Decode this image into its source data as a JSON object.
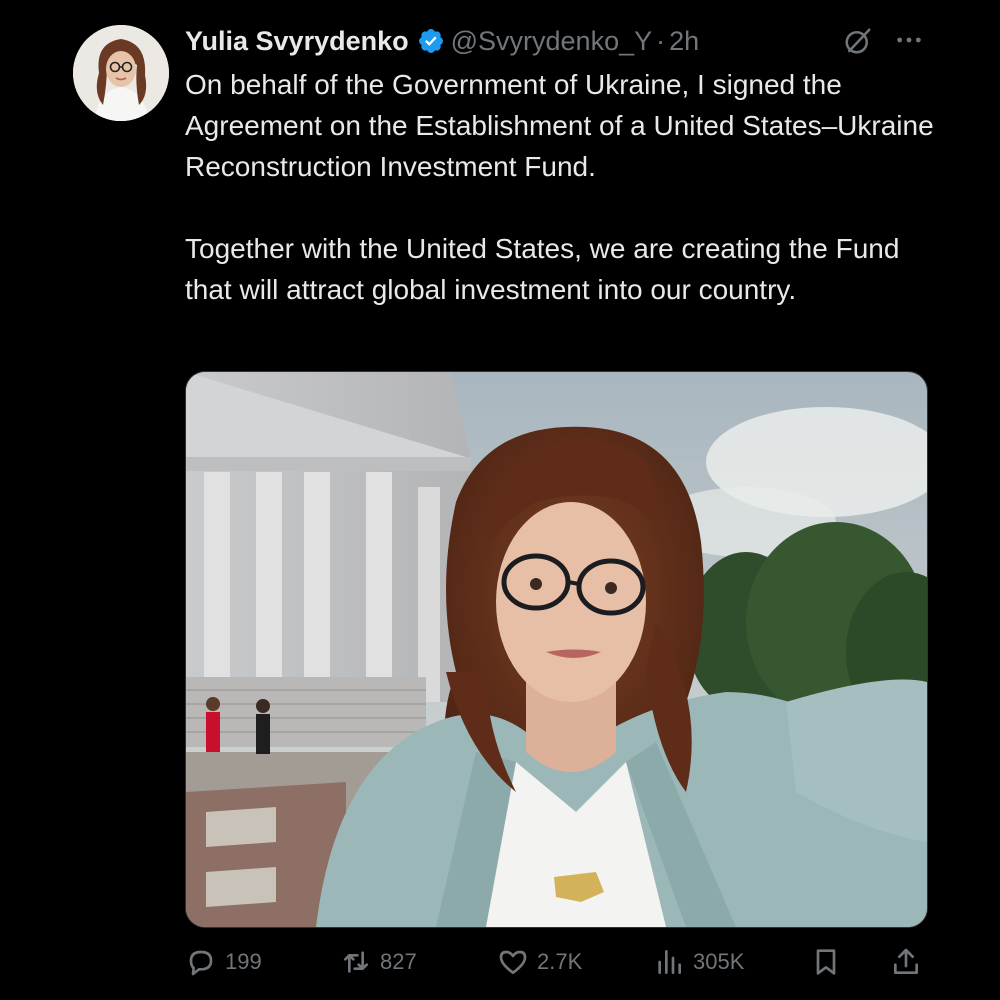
{
  "author": {
    "name": "Yulia Svyrydenko",
    "handle": "@Svyrydenko_Y",
    "separator": "·",
    "time": "2h",
    "verified": true
  },
  "tweet": {
    "paragraphs": [
      "On behalf of the Government of Ukraine, I signed the Agreement on the Establishment of a United States–Ukraine Reconstruction Investment Fund.",
      "Together with the United States, we are creating the Fund that will attract global investment into our country."
    ]
  },
  "actions": {
    "replies": "199",
    "reposts": "827",
    "likes": "2.7K",
    "views": "305K"
  },
  "icons": {
    "verified": "verified-badge-icon",
    "grok": "grok-icon",
    "more": "more-icon",
    "reply": "reply-icon",
    "repost": "repost-icon",
    "like": "heart-icon",
    "views": "views-icon",
    "bookmark": "bookmark-icon",
    "share": "share-icon"
  },
  "colors": {
    "background": "#000000",
    "text": "#e7e9ea",
    "muted": "#71767b",
    "verified": "#1d9bf0"
  }
}
